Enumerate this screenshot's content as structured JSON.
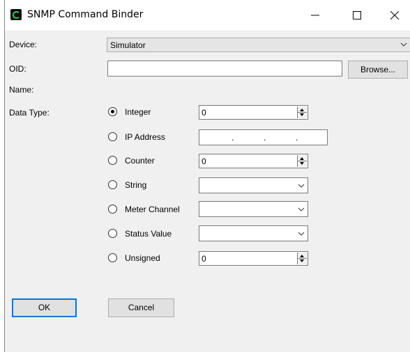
{
  "window": {
    "title": "SNMP Command Binder",
    "controls": {
      "minimize": "—",
      "maximize": "☐",
      "close": "✕"
    }
  },
  "form": {
    "device_label": "Device:",
    "device_value": "Simulator",
    "oid_label": "OID:",
    "oid_value": "",
    "browse_label": "Browse...",
    "name_label": "Name:",
    "data_type_label": "Data Type:"
  },
  "data_types": [
    {
      "label": "Integer",
      "checked": true,
      "control": "spin",
      "value": "0"
    },
    {
      "label": "IP Address",
      "checked": false,
      "control": "ip",
      "value": ""
    },
    {
      "label": "Counter",
      "checked": false,
      "control": "spin",
      "value": "0"
    },
    {
      "label": "String",
      "checked": false,
      "control": "combo",
      "value": ""
    },
    {
      "label": "Meter Channel",
      "checked": false,
      "control": "combo",
      "value": ""
    },
    {
      "label": "Status Value",
      "checked": false,
      "control": "combo",
      "value": ""
    },
    {
      "label": "Unsigned",
      "checked": false,
      "control": "spin",
      "value": "0"
    }
  ],
  "buttons": {
    "ok": "OK",
    "cancel": "Cancel"
  },
  "colors": {
    "accent": "#0078d7",
    "dialog_bg": "#f0f0f0",
    "icon_green": "#2ecc40"
  }
}
